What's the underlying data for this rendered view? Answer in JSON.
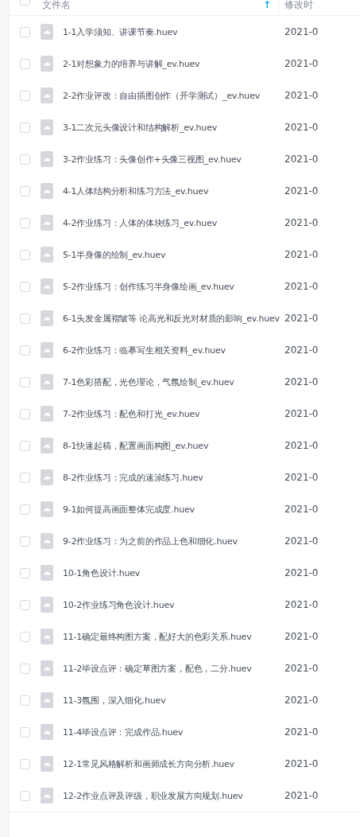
{
  "header": {
    "checked": false,
    "name_column": "文件名",
    "sort_icon": "↑",
    "date_column": "修改时"
  },
  "rows": [
    {
      "name": "1-1入学须知、讲课节奏.huev",
      "date": "2021-0",
      "checked": false
    },
    {
      "name": "2-1对想象力的培养与讲解_ev.huev",
      "date": "2021-0",
      "checked": false
    },
    {
      "name": "2-2作业评改：自由插图创作（开学测试）_ev.huev",
      "date": "2021-0",
      "checked": false
    },
    {
      "name": "3-1二次元头像设计和结构解析_ev.huev",
      "date": "2021-0",
      "checked": false
    },
    {
      "name": "3-2作业练习：头像创作+头像三视图_ev.huev",
      "date": "2021-0",
      "checked": false
    },
    {
      "name": "4-1人体结构分析和练习方法_ev.huev",
      "date": "2021-0",
      "checked": false
    },
    {
      "name": "4-2作业练习：人体的体块练习_ev.huev",
      "date": "2021-0",
      "checked": false
    },
    {
      "name": "5-1半身像的绘制_ev.huev",
      "date": "2021-0",
      "checked": false
    },
    {
      "name": "5-2作业练习：创作练习半身像绘画_ev.huev",
      "date": "2021-0",
      "checked": false
    },
    {
      "name": "6-1头发金属褶皱等 论高光和反光对材质的影响_ev.huev",
      "date": "2021-0",
      "checked": false
    },
    {
      "name": "6-2作业练习：临摹写生相关资料_ev.huev",
      "date": "2021-0",
      "checked": false
    },
    {
      "name": "7-1色彩搭配，光色理论，气氛绘制_ev.huev",
      "date": "2021-0",
      "checked": false
    },
    {
      "name": "7-2作业练习：配色和打光_ev.huev",
      "date": "2021-0",
      "checked": false
    },
    {
      "name": "8-1快速起稿，配置画面构图_ev.huev",
      "date": "2021-0",
      "checked": false
    },
    {
      "name": "8-2作业练习：完成的速涂练习.huev",
      "date": "2021-0",
      "checked": false
    },
    {
      "name": "9-1如何提高画面整体完成度.huev",
      "date": "2021-0",
      "checked": false
    },
    {
      "name": "9-2作业练习：为之前的作品上色和细化.huev",
      "date": "2021-0",
      "checked": false
    },
    {
      "name": "10-1角色设计.huev",
      "date": "2021-0",
      "checked": false
    },
    {
      "name": "10-2作业练习角色设计.huev",
      "date": "2021-0",
      "checked": false
    },
    {
      "name": "11-1确定最终构图方案，配好大的色彩关系.huev",
      "date": "2021-0",
      "checked": false
    },
    {
      "name": "11-2毕设点评：确定草图方案，配色，二分.huev",
      "date": "2021-0",
      "checked": false
    },
    {
      "name": "11-3氛围，深入细化.huev",
      "date": "2021-0",
      "checked": false
    },
    {
      "name": "11-4毕设点评：完成作品.huev",
      "date": "2021-0",
      "checked": false
    },
    {
      "name": "12-1常见风格解析和画师成长方向分析.huev",
      "date": "2021-0",
      "checked": false
    },
    {
      "name": "12-2作业点评及评级，职业发展方向规划.huev",
      "date": "2021-0",
      "checked": false
    }
  ]
}
